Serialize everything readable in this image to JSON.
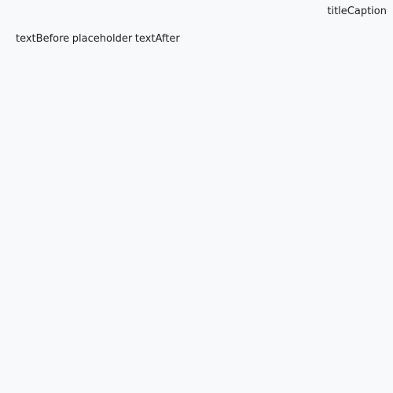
{
  "title_caption": "titleCaption",
  "content": {
    "text_before": "textBefore",
    "placeholder": "placeholder",
    "text_after": "textAfter"
  }
}
